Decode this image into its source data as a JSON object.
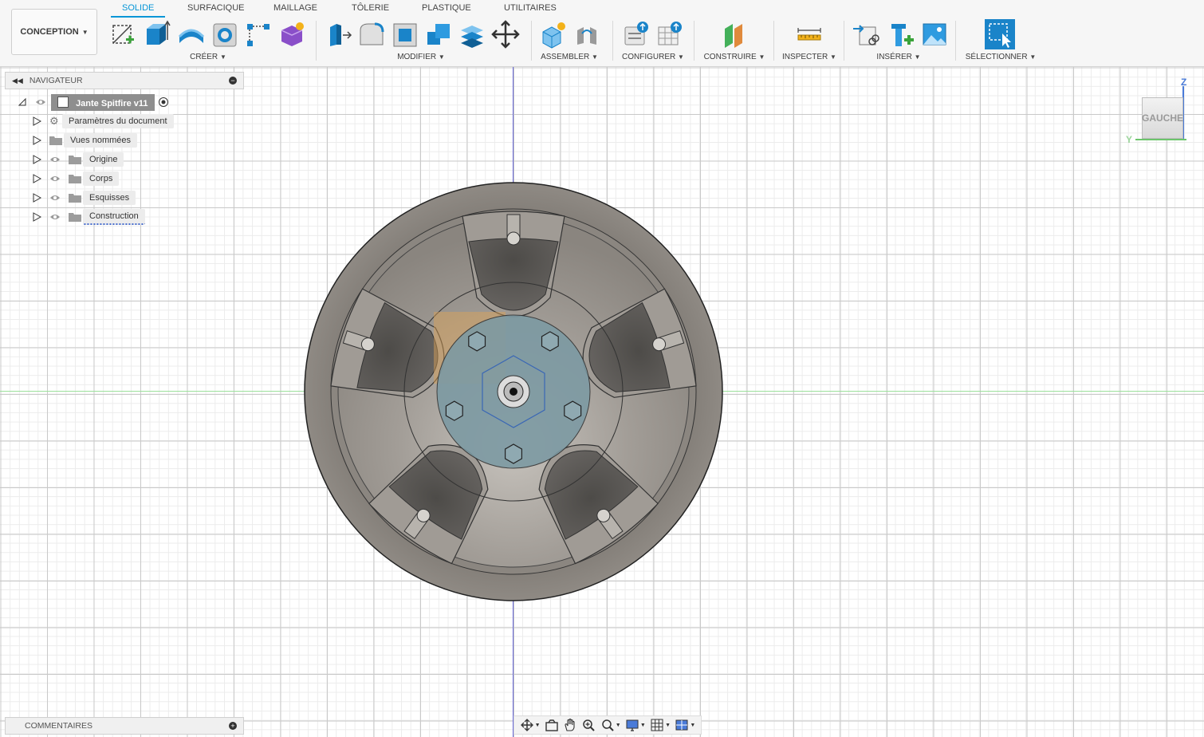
{
  "workspace": {
    "label": "CONCEPTION"
  },
  "tabs": [
    {
      "label": "SOLIDE",
      "active": true
    },
    {
      "label": "SURFACIQUE"
    },
    {
      "label": "MAILLAGE"
    },
    {
      "label": "TÔLERIE"
    },
    {
      "label": "PLASTIQUE"
    },
    {
      "label": "UTILITAIRES"
    }
  ],
  "groups": {
    "creer": "CRÉER",
    "modifier": "MODIFIER",
    "assembler": "ASSEMBLER",
    "configurer": "CONFIGURER",
    "construire": "CONSTRUIRE",
    "inspecter": "INSPECTER",
    "inserer": "INSÉRER",
    "selectionner": "SÉLECTIONNER"
  },
  "navigator": {
    "title": "NAVIGATEUR",
    "root": "Jante Spitfire v11",
    "items": [
      {
        "label": "Paramètres du document",
        "icon": "gear-icon"
      },
      {
        "label": "Vues nommées",
        "icon": "folder-icon"
      },
      {
        "label": "Origine",
        "icon": "folder-icon"
      },
      {
        "label": "Corps",
        "icon": "folder-icon"
      },
      {
        "label": "Esquisses",
        "icon": "folder-icon"
      },
      {
        "label": "Construction",
        "icon": "folder-icon"
      }
    ]
  },
  "viewcube": {
    "face": "GAUCHE",
    "axis_up": "Z",
    "axis_side": "Y"
  },
  "comments": {
    "title": "COMMENTAIRES"
  },
  "colors": {
    "accent": "#0696d7",
    "wheel_body": "#8a857f",
    "axis_vertical": "#6b6bd8",
    "axis_horizontal": "#9be09b"
  }
}
